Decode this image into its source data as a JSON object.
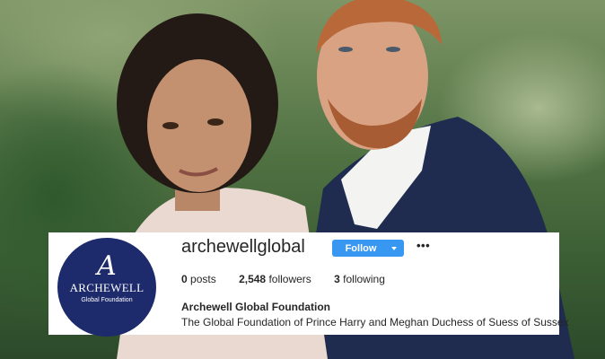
{
  "profile": {
    "logo": {
      "mark": "A",
      "name": "ARCHEWELL",
      "subtitle": "Global Foundation",
      "background": "#1d2a6b"
    },
    "username": "archewellglobal",
    "follow_label": "Follow",
    "dropdown_icon": "chevron-down-icon",
    "more_icon_glyph": "•••",
    "stats": {
      "posts_count": "0",
      "posts_label": "posts",
      "followers_count": "2,548",
      "followers_label": "followers",
      "following_count": "3",
      "following_label": "following"
    },
    "display_name": "Archewell Global Foundation",
    "bio": "The Global Foundation of Prince Harry and Meghan Duchess of Suess of Sussex"
  },
  "colors": {
    "follow_button": "#3897f0",
    "text": "#262626",
    "card_background": "#ffffff"
  }
}
